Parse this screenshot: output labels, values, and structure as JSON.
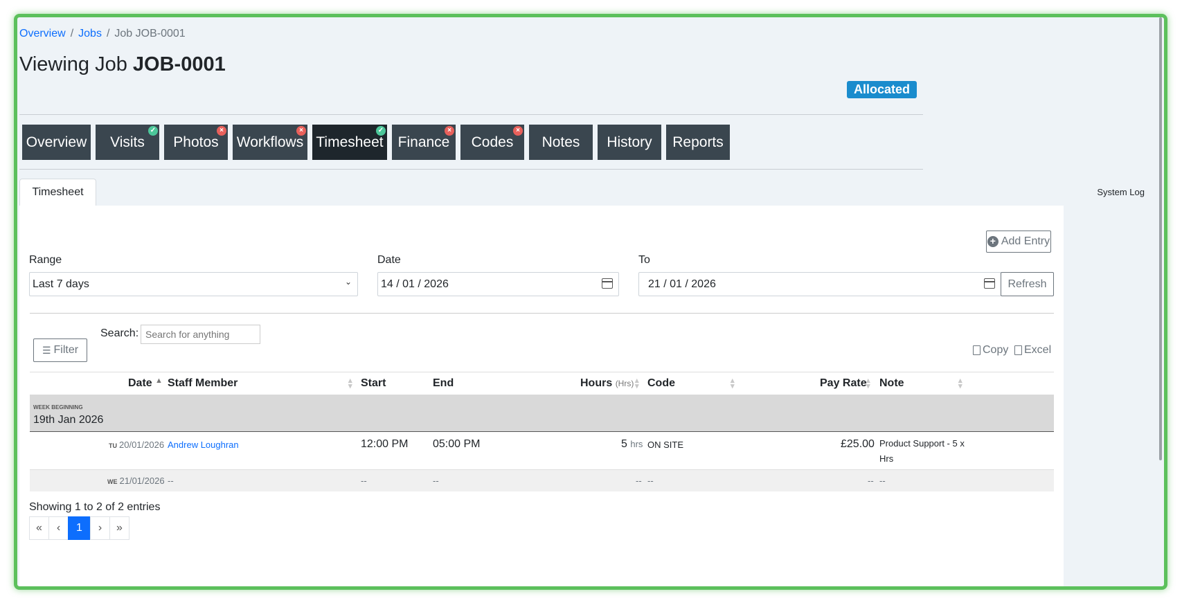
{
  "breadcrumb": {
    "items": [
      "Overview",
      "Jobs"
    ],
    "current": "Job JOB-0001",
    "sep": "/"
  },
  "title": {
    "prefix": "Viewing Job",
    "job": "JOB-0001"
  },
  "status": "Allocated",
  "tabs": [
    {
      "label": "Overview",
      "badge": ""
    },
    {
      "label": "Visits",
      "badge": "ok"
    },
    {
      "label": "Photos",
      "badge": "err"
    },
    {
      "label": "Workflows",
      "badge": "err"
    },
    {
      "label": "Timesheet",
      "badge": "ok",
      "active": true
    },
    {
      "label": "Finance",
      "badge": "err"
    },
    {
      "label": "Codes",
      "badge": "err"
    },
    {
      "label": "Notes",
      "badge": ""
    },
    {
      "label": "History",
      "badge": ""
    },
    {
      "label": "Reports",
      "badge": ""
    }
  ],
  "subtab": "Timesheet",
  "system_log": "System Log",
  "add_entry": "Add Entry",
  "filters": {
    "range_label": "Range",
    "range_value": "Last 7 days",
    "date_label": "Date",
    "date_value": "14 / 01 / 2026",
    "to_label": "To",
    "to_value": "21 / 01 / 2026",
    "refresh": "Refresh"
  },
  "table_tools": {
    "filter": "Filter",
    "search_label": "Search:",
    "search_placeholder": "Search for anything",
    "copy": "Copy",
    "excel": "Excel"
  },
  "columns": {
    "date": "Date",
    "staff": "Staff Member",
    "start": "Start",
    "end": "End",
    "hours": "Hours",
    "hours_unit": "(Hrs)",
    "code": "Code",
    "pay_rate": "Pay Rate",
    "note": "Note"
  },
  "group": {
    "caption": "WEEK BEGINNING",
    "label": "19th Jan 2026"
  },
  "rows": [
    {
      "dow": "TU",
      "date": "20/01/2026",
      "staff": "Andrew Loughran",
      "start": "12:00 PM",
      "end": "05:00 PM",
      "hours": "5",
      "hours_unit": "hrs",
      "code": "ON SITE",
      "pay_rate": "£25.00",
      "note": "Product Support - 5 x Hrs"
    },
    {
      "dow": "WE",
      "date": "21/01/2026",
      "staff": "--",
      "start": "--",
      "end": "--",
      "hours": "--",
      "code": "--",
      "pay_rate": "--",
      "note": "--"
    }
  ],
  "info": "Showing 1 to 2 of 2 entries",
  "pager": [
    "«",
    "‹",
    "1",
    "›",
    "»"
  ],
  "colors": {
    "accent": "#0d6efd",
    "tab_bg": "#3a464f",
    "badge": "#1a8ccd",
    "frame": "#5cc05c"
  }
}
